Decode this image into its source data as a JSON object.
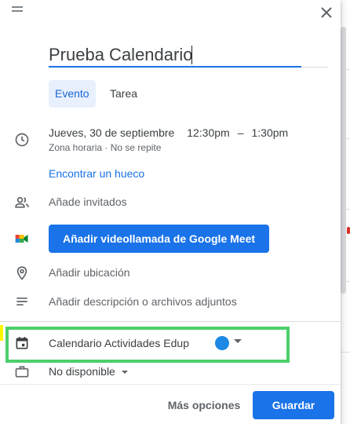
{
  "header": {
    "drag_icon": "drag-handle-icon",
    "close_icon": "close-icon"
  },
  "title": {
    "value": "Prueba Calendario",
    "accent": "#1a73e8"
  },
  "tabs": [
    {
      "label": "Evento",
      "active": true
    },
    {
      "label": "Tarea",
      "active": false
    }
  ],
  "datetime": {
    "date": "Jueves, 30 de septiembre",
    "start": "12:30pm",
    "separator": "–",
    "end": "1:30pm",
    "timezone": "Zona horaria",
    "dot": "·",
    "repeat": "No se repite",
    "icon": "clock-icon"
  },
  "find_slot_label": "Encontrar un hueco",
  "guests": {
    "label": "Añade invitados",
    "icon": "people-icon"
  },
  "meet": {
    "label": "Añadir videollamada de Google Meet",
    "icon": "google-meet-icon"
  },
  "location": {
    "label": "Añadir ubicación",
    "icon": "location-pin-icon"
  },
  "description": {
    "label": "Añadir descripción o archivos adjuntos",
    "icon": "notes-icon"
  },
  "calendar": {
    "name": "Calendario Actividades Edup",
    "color": "#1e88e5",
    "icon": "calendar-icon",
    "highlight_color": "#4ccf6b"
  },
  "availability": {
    "label": "No disponible",
    "icon": "briefcase-icon"
  },
  "footer": {
    "more_options": "Más opciones",
    "save": "Guardar"
  }
}
